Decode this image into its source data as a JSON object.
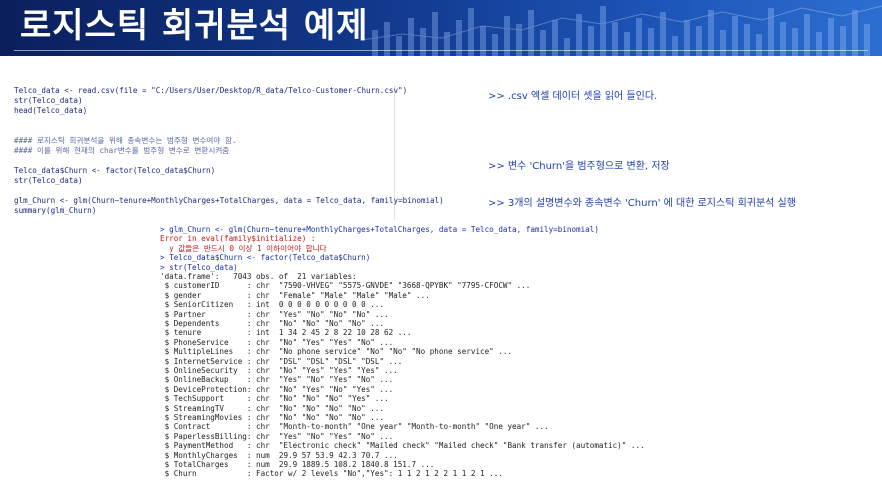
{
  "header": {
    "title": "로지스틱 회귀분석 예제"
  },
  "script": {
    "lines": [
      {
        "text": "Telco_data <- read.csv(file = \"C:/Users/User/Desktop/R_data/Telco-Customer-Churn.csv\")",
        "type": "code"
      },
      {
        "text": "str(Telco_data)",
        "type": "code"
      },
      {
        "text": "head(Telco_data)",
        "type": "code"
      },
      {
        "text": "",
        "type": "code"
      },
      {
        "text": "",
        "type": "code"
      },
      {
        "text": "#### 로지스틱 회귀분석을 위해 종속변수는 범주형 변수여야 함.",
        "type": "comment"
      },
      {
        "text": "#### 이를 위해 현재의 char변수를 범주형 변수로 변환시켜줌",
        "type": "comment"
      },
      {
        "text": "",
        "type": "code"
      },
      {
        "text": "Telco_data$Churn <- factor(Telco_data$Churn)",
        "type": "code"
      },
      {
        "text": "str(Telco_data)",
        "type": "code"
      },
      {
        "text": "",
        "type": "code"
      },
      {
        "text": "glm_Churn <- glm(Churn~tenure+MonthlyCharges+TotalCharges, data = Telco_data, family=binomial)",
        "type": "code"
      },
      {
        "text": "summary(glm_Churn)",
        "type": "code"
      }
    ]
  },
  "notes": [
    ">> .csv 엑셀 데이터 셋을 읽어 들인다.",
    ">> 변수 'Churn'을 범주형으로 변환, 저장",
    ">> 3개의 설명변수와 종속변수 'Churn' 에 대한 로지스틱 회귀분석 실행"
  ],
  "console": {
    "lines": [
      {
        "text": "> glm_Churn <- glm(Churn~tenure+MonthlyCharges+TotalCharges, data = Telco_data, family=binomial)",
        "type": "cmd"
      },
      {
        "text": "Error in eval(family$initialize) :",
        "type": "err"
      },
      {
        "text": "  y 값들은 반드시 0 이상 1 이하이어야 합니다",
        "type": "err"
      },
      {
        "text": "> Telco_data$Churn <- factor(Telco_data$Churn)",
        "type": "cmd"
      },
      {
        "text": "> str(Telco_data)",
        "type": "cmd"
      },
      {
        "text": "'data.frame':   7043 obs. of  21 variables:",
        "type": "out"
      },
      {
        "text": " $ customerID      : chr  \"7590-VHVEG\" \"5575-GNVDE\" \"3668-QPYBK\" \"7795-CFOCW\" ...",
        "type": "out"
      },
      {
        "text": " $ gender          : chr  \"Female\" \"Male\" \"Male\" \"Male\" ...",
        "type": "out"
      },
      {
        "text": " $ SeniorCitizen   : int  0 0 0 0 0 0 0 0 0 0 ...",
        "type": "out"
      },
      {
        "text": " $ Partner         : chr  \"Yes\" \"No\" \"No\" \"No\" ...",
        "type": "out"
      },
      {
        "text": " $ Dependents      : chr  \"No\" \"No\" \"No\" \"No\" ...",
        "type": "out"
      },
      {
        "text": " $ tenure          : int  1 34 2 45 2 8 22 10 28 62 ...",
        "type": "out"
      },
      {
        "text": " $ PhoneService    : chr  \"No\" \"Yes\" \"Yes\" \"No\" ...",
        "type": "out"
      },
      {
        "text": " $ MultipleLines   : chr  \"No phone service\" \"No\" \"No\" \"No phone service\" ...",
        "type": "out"
      },
      {
        "text": " $ InternetService : chr  \"DSL\" \"DSL\" \"DSL\" \"DSL\" ...",
        "type": "out"
      },
      {
        "text": " $ OnlineSecurity  : chr  \"No\" \"Yes\" \"Yes\" \"Yes\" ...",
        "type": "out"
      },
      {
        "text": " $ OnlineBackup    : chr  \"Yes\" \"No\" \"Yes\" \"No\" ...",
        "type": "out"
      },
      {
        "text": " $ DeviceProtection: chr  \"No\" \"Yes\" \"No\" \"Yes\" ...",
        "type": "out"
      },
      {
        "text": " $ TechSupport     : chr  \"No\" \"No\" \"No\" \"Yes\" ...",
        "type": "out"
      },
      {
        "text": " $ StreamingTV     : chr  \"No\" \"No\" \"No\" \"No\" ...",
        "type": "out"
      },
      {
        "text": " $ StreamingMovies : chr  \"No\" \"No\" \"No\" \"No\" ...",
        "type": "out"
      },
      {
        "text": " $ Contract        : chr  \"Month-to-month\" \"One year\" \"Month-to-month\" \"One year\" ...",
        "type": "out"
      },
      {
        "text": " $ PaperlessBilling: chr  \"Yes\" \"No\" \"Yes\" \"No\" ...",
        "type": "out"
      },
      {
        "text": " $ PaymentMethod   : chr  \"Electronic check\" \"Mailed check\" \"Mailed check\" \"Bank transfer (automatic)\" ...",
        "type": "out"
      },
      {
        "text": " $ MonthlyCharges  : num  29.9 57 53.9 42.3 70.7 ...",
        "type": "out"
      },
      {
        "text": " $ TotalCharges    : num  29.9 1889.5 108.2 1840.8 151.7 ...",
        "type": "out"
      },
      {
        "text": " $ Churn           : Factor w/ 2 levels \"No\",\"Yes\": 1 1 2 1 2 2 1 1 2 1 ...",
        "type": "out"
      }
    ]
  }
}
